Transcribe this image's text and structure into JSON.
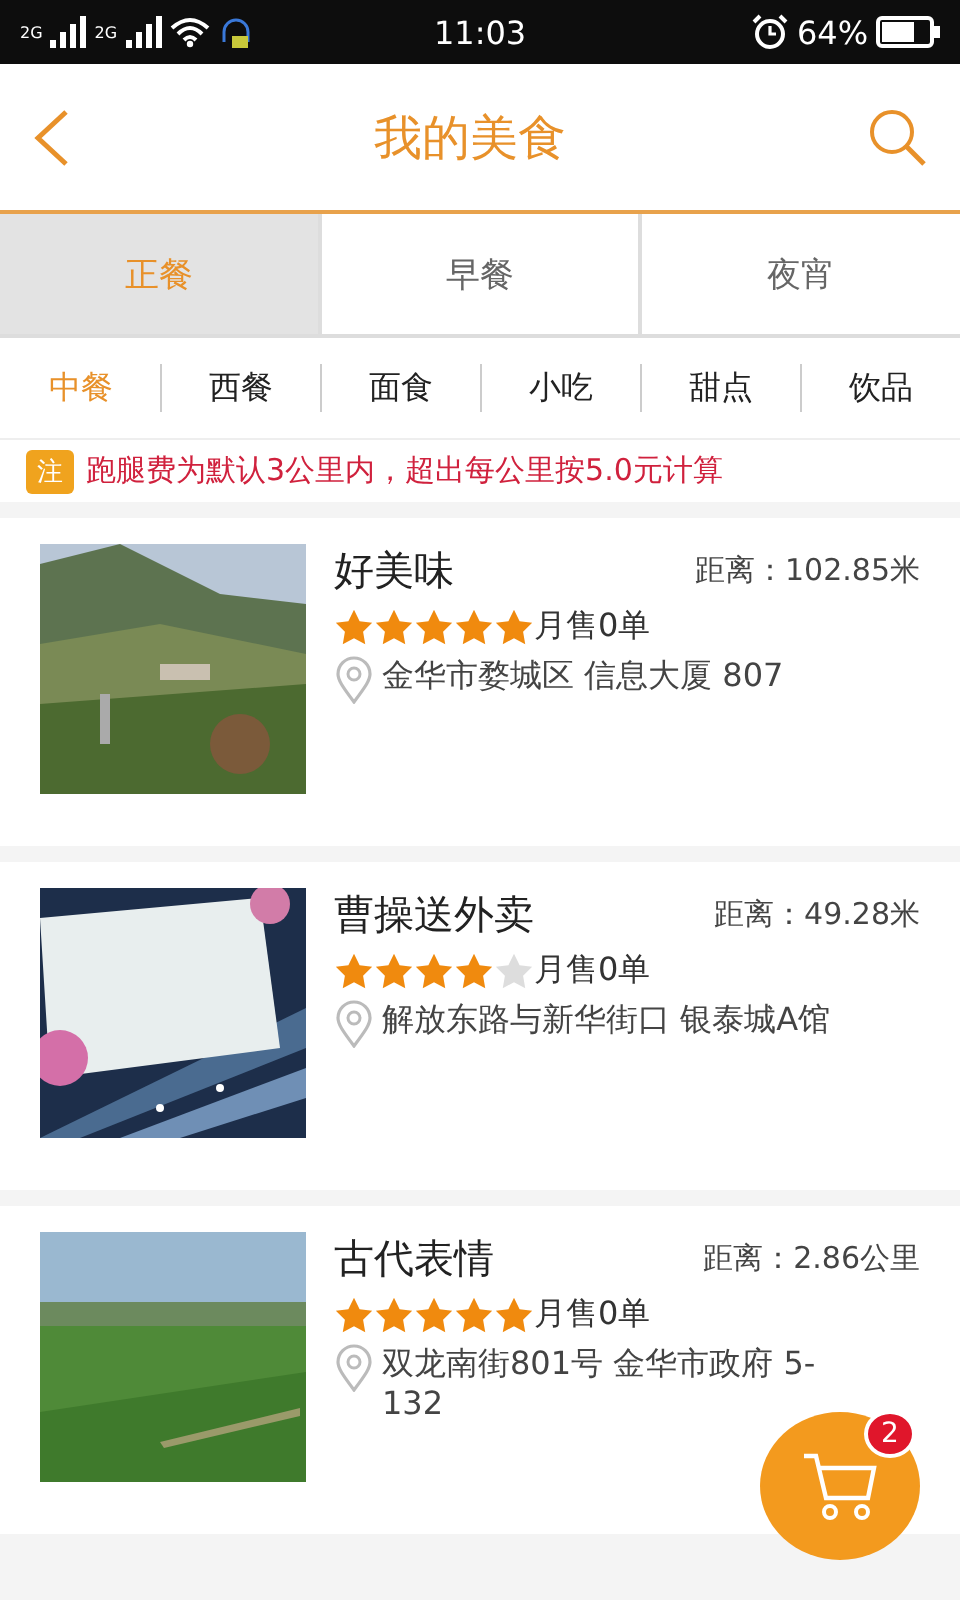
{
  "status_bar": {
    "signal_1": "2G",
    "signal_2": "2G",
    "time": "11:03",
    "battery": "64%"
  },
  "header": {
    "title": "我的美食"
  },
  "meal_tabs": [
    {
      "label": "正餐",
      "selected": true
    },
    {
      "label": "早餐",
      "selected": false
    },
    {
      "label": "夜宵",
      "selected": false
    }
  ],
  "categories": [
    {
      "label": "中餐",
      "selected": true
    },
    {
      "label": "西餐",
      "selected": false
    },
    {
      "label": "面食",
      "selected": false
    },
    {
      "label": "小吃",
      "selected": false
    },
    {
      "label": "甜点",
      "selected": false
    },
    {
      "label": "饮品",
      "selected": false
    }
  ],
  "notice": {
    "badge": "注",
    "text": "跑腿费为默认3公里内，超出每公里按5.0元计算"
  },
  "shops": [
    {
      "name": "好美味",
      "distance": "距离：102.85米",
      "stars": 5,
      "sales": "月售0单",
      "address": "金华市婺城区 信息大厦 807"
    },
    {
      "name": "曹操送外卖",
      "distance": "距离：49.28米",
      "stars": 4,
      "sales": "月售0单",
      "address": "解放东路与新华街口 银泰城A馆"
    },
    {
      "name": "古代表情",
      "distance": "距离：2.86公里",
      "stars": 5,
      "sales": "月售0单",
      "address": "双龙南街801号 金华市政府 5-132"
    }
  ],
  "cart": {
    "count": "2"
  }
}
